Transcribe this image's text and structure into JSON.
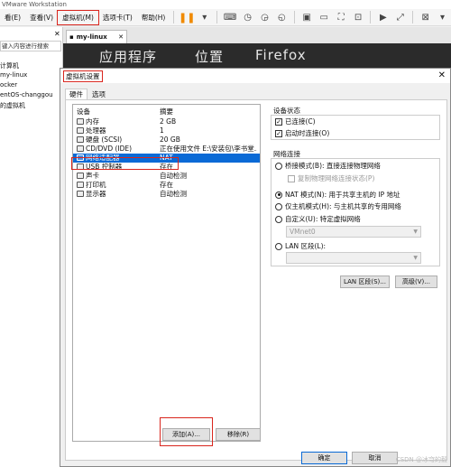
{
  "app": {
    "title": "VMware Workstation"
  },
  "menu": {
    "items": [
      "看(E)",
      "查看(V)",
      "虚拟机(M)",
      "选项卡(T)",
      "帮助(H)"
    ]
  },
  "library": {
    "search_placeholder": "键入内容进行搜索",
    "items": [
      "计算机",
      "my-linux",
      "ocker",
      "entOS-changgou",
      "的虚拟机"
    ]
  },
  "vm_tab": {
    "label": "my-linux"
  },
  "guest_topbar": {
    "applications": "应用程序",
    "places": "位置",
    "firefox": "Firefox"
  },
  "dialog": {
    "title": "虚拟机设置",
    "tabs": [
      "硬件",
      "选项"
    ],
    "device_list": {
      "headers": [
        "设备",
        "摘要"
      ],
      "rows": [
        {
          "device": "内存",
          "summary": "2 GB"
        },
        {
          "device": "处理器",
          "summary": "1"
        },
        {
          "device": "硬盘 (SCSI)",
          "summary": "20 GB"
        },
        {
          "device": "CD/DVD (IDE)",
          "summary": "正在使用文件 E:\\安装包\\李书堂..."
        },
        {
          "device": "网络适配器",
          "summary": "NAT",
          "selected": true
        },
        {
          "device": "USB 控制器",
          "summary": "存在"
        },
        {
          "device": "声卡",
          "summary": "自动检测"
        },
        {
          "device": "打印机",
          "summary": "存在"
        },
        {
          "device": "显示器",
          "summary": "自动检测"
        }
      ]
    },
    "add_button": "添加(A)...",
    "remove_button": "移除(R)",
    "device_status": {
      "label": "设备状态",
      "connected": "已连接(C)",
      "connect_at_power_on": "启动时连接(O)"
    },
    "network": {
      "label": "网络连接",
      "bridged": "桥接模式(B): 直接连接物理网络",
      "replicate": "复制物理网络连接状态(P)",
      "nat": "NAT 模式(N): 用于共享主机的 IP 地址",
      "host_only": "仅主机模式(H): 与主机共享的专用网络",
      "custom": "自定义(U): 特定虚拟网络",
      "custom_value": "VMnet0",
      "lan_segment": "LAN 区段(L):",
      "selected": "nat"
    },
    "lan_segments_button": "LAN 区段(S)...",
    "advanced_button": "高级(V)...",
    "ok_button": "确定",
    "cancel_button": "取消"
  },
  "watermark": "CSDN @冰穹的毅"
}
